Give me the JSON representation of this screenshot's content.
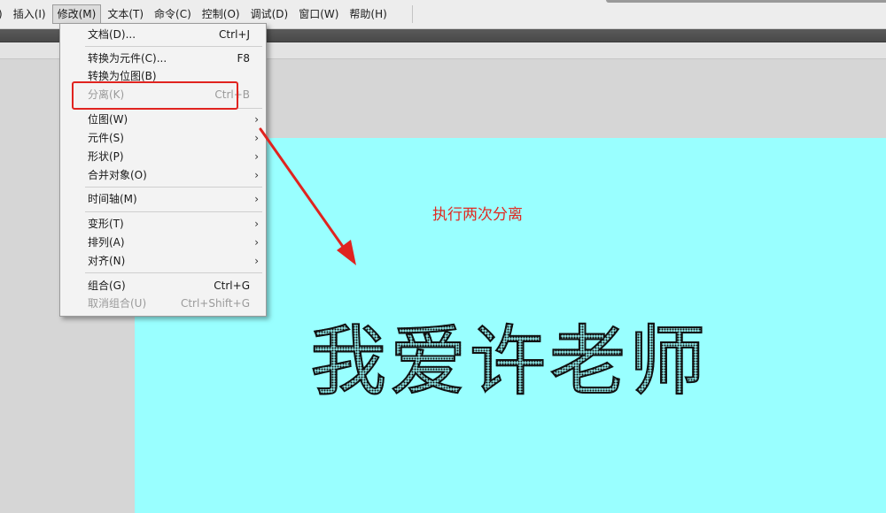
{
  "menubar": {
    "items": [
      {
        "label": ")"
      },
      {
        "label": "插入(I)"
      },
      {
        "label": "修改(M)"
      },
      {
        "label": "文本(T)"
      },
      {
        "label": "命令(C)"
      },
      {
        "label": "控制(O)"
      },
      {
        "label": "调试(D)"
      },
      {
        "label": "窗口(W)"
      },
      {
        "label": "帮助(H)"
      }
    ]
  },
  "dropdown": {
    "items": [
      {
        "label": "文档(D)...",
        "shortcut": "Ctrl+J"
      },
      {
        "label": "转换为元件(C)...",
        "shortcut": "F8"
      },
      {
        "label": "转换为位图(B)",
        "shortcut": ""
      },
      {
        "label": "分离(K)",
        "shortcut": "Ctrl+B"
      },
      {
        "label": "位图(W)",
        "arrow": "›"
      },
      {
        "label": "元件(S)",
        "arrow": "›"
      },
      {
        "label": "形状(P)",
        "arrow": "›"
      },
      {
        "label": "合并对象(O)",
        "arrow": "›"
      },
      {
        "label": "时间轴(M)",
        "arrow": "›"
      },
      {
        "label": "变形(T)",
        "arrow": "›"
      },
      {
        "label": "排列(A)",
        "arrow": "›"
      },
      {
        "label": "对齐(N)",
        "arrow": "›"
      },
      {
        "label": "组合(G)",
        "shortcut": "Ctrl+G"
      },
      {
        "label": "取消组合(U)",
        "shortcut": "Ctrl+Shift+G"
      }
    ]
  },
  "stage": {
    "annotation": "执行两次分离",
    "text": "我爱许老师",
    "background": "#99ffff"
  },
  "colors": {
    "annotation": "#e02a22",
    "highlight": "#e0231f"
  }
}
